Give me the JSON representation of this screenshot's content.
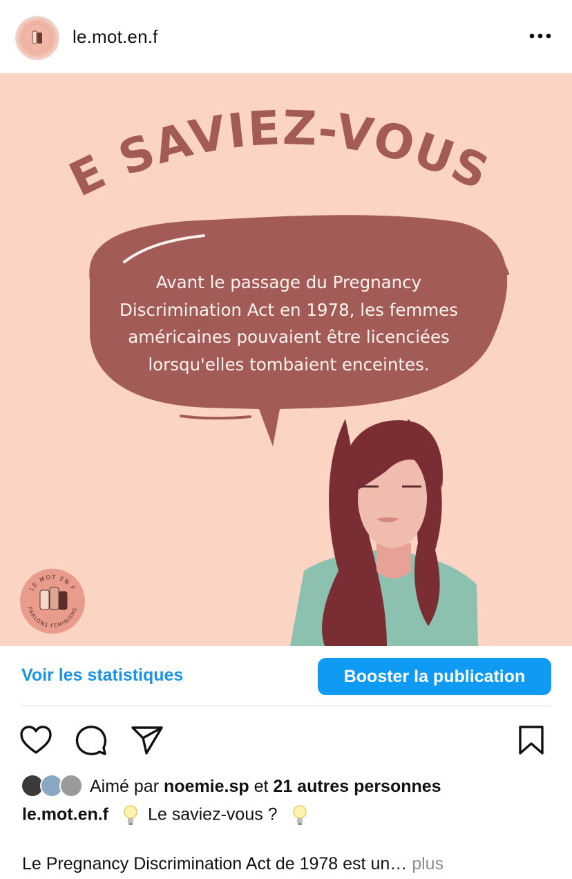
{
  "header": {
    "username": "le.mot.en.f",
    "avatar_icon": "profile-avatar-logo",
    "more_icon": "more-dots-icon"
  },
  "post": {
    "background": "#fcd4c3",
    "accent": "#a35b58",
    "headline": "LE SAVIEZ-VOUS ?",
    "bubble_text": "Avant le passage du Pregnancy Discrimination Act en 1978, les femmes américaines pouvaient être licenciées lorsqu'elles tombaient enceintes.",
    "logo_top": "LE MOT EN F",
    "logo_bottom": "PARLONS FEMINISME"
  },
  "actions": {
    "stats_label": "Voir les statistiques",
    "boost_label": "Booster la publication",
    "boost_color": "#0f9af3",
    "link_color": "#1a93e8",
    "icons": [
      "heart-icon",
      "comment-icon",
      "send-icon",
      "bookmark-icon"
    ]
  },
  "likes": {
    "prefix": "Aimé par",
    "first_user": "noemie.sp",
    "connector": "et",
    "others": "21 autres personnes"
  },
  "caption": {
    "username": "le.mot.en.f",
    "text": "Le saviez-vous ?",
    "emoji_icon": "lightbulb-icon",
    "body": "Le Pregnancy Discrimination Act de 1978 est un…",
    "more": "plus"
  }
}
